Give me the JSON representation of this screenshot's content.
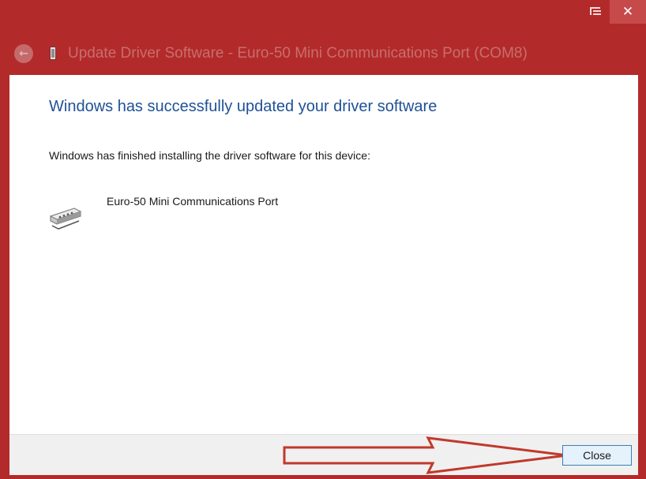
{
  "window": {
    "title": "Update Driver Software - Euro-50 Mini Communications Port (COM8)",
    "accent_color": "#b32a2a",
    "caption_close_glyph": "✕"
  },
  "nav": {
    "back_icon": "back-arrow-icon",
    "back_glyph": "←"
  },
  "content": {
    "headline": "Windows has successfully updated your driver software",
    "info": "Windows has finished installing the driver software for this device:",
    "device_name": "Euro-50 Mini Communications Port",
    "device_icon": "serial-port-icon"
  },
  "footer": {
    "close_label": "Close",
    "annotation": "red-arrow-pointing-to-close",
    "annotation_color": "#c0392b"
  }
}
